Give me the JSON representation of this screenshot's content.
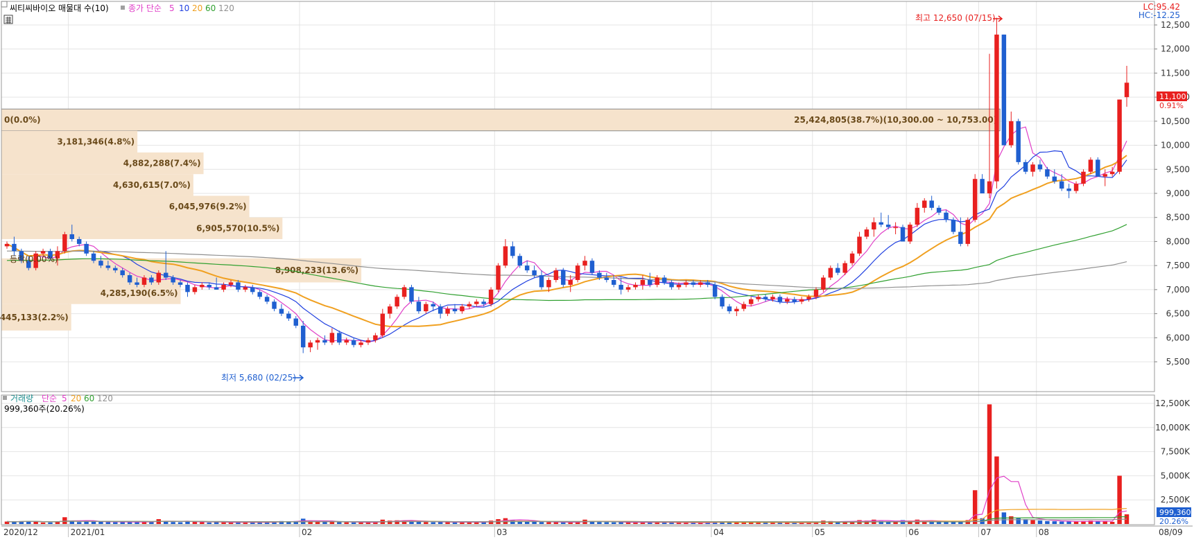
{
  "header": {
    "title": "씨티씨바이오 매물대 수(10)",
    "ma_prefix": "종가 단순",
    "ma_periods": [
      "5",
      "10",
      "20",
      "60",
      "120"
    ]
  },
  "volume_header": {
    "title": "거래량",
    "ma_prefix": "단순",
    "ma_periods": [
      "5",
      "20",
      "60",
      "120"
    ],
    "last_value": "999,360주(20.26%)"
  },
  "indicators": {
    "lc": "LC:95.42",
    "hc": "HC:-12.25"
  },
  "current": {
    "price": "11,100",
    "change": "0.91%",
    "volume": "999,360",
    "volume_pct": "20.26%"
  },
  "colors": {
    "up": "#e8201f",
    "down": "#1f5fd0",
    "ma5": "#e040c8",
    "ma10": "#2040e0",
    "ma20": "#f0a020",
    "ma60": "#30a030",
    "ma120": "#909090",
    "profile": "#f6e3cc",
    "grid": "#e4e4e4"
  },
  "annotations": {
    "high": "최고 12,650 (07/15)",
    "low": "최저 5,680 (02/25)",
    "ret": "등락(0.00%)"
  },
  "chart_data": {
    "type": "candlestick",
    "price_axis": {
      "ticks": [
        12500,
        12000,
        11500,
        11000,
        10500,
        10000,
        9500,
        9000,
        8500,
        8000,
        7500,
        7000,
        6500,
        6000,
        5500
      ],
      "tick_labels": [
        "12,500",
        "12,000",
        "11,500",
        "11,000",
        "10,500",
        "10,000",
        "9,500",
        "9,000",
        "8,500",
        "8,000",
        "7,500",
        "7,000",
        "6,500",
        "6,000",
        "5,500"
      ]
    },
    "volume_axis": {
      "ticks": [
        12500,
        10000,
        7500,
        5000,
        2500
      ],
      "tick_labels": [
        "12,500K",
        "10,000K",
        "7,500K",
        "5,000K",
        "2,500K"
      ]
    },
    "x_labels": [
      "2020/12",
      "2021/01",
      "02",
      "03",
      "04",
      "05",
      "06",
      "07",
      "08",
      "08/09"
    ],
    "candles": [
      [
        7900,
        8000,
        7850,
        7950,
        250
      ],
      [
        7950,
        8100,
        7700,
        7800,
        220
      ],
      [
        7800,
        7850,
        7550,
        7600,
        280
      ],
      [
        7600,
        7700,
        7400,
        7450,
        300
      ],
      [
        7450,
        7800,
        7400,
        7750,
        260
      ],
      [
        7750,
        7850,
        7700,
        7800,
        150
      ],
      [
        7800,
        7850,
        7600,
        7650,
        160
      ],
      [
        7650,
        7900,
        7500,
        7800,
        250
      ],
      [
        7800,
        8200,
        7750,
        8150,
        700
      ],
      [
        8150,
        8350,
        8000,
        8050,
        350
      ],
      [
        8050,
        8100,
        7900,
        7950,
        200
      ],
      [
        7950,
        8000,
        7700,
        7750,
        250
      ],
      [
        7750,
        7800,
        7550,
        7600,
        230
      ],
      [
        7600,
        7700,
        7450,
        7500,
        280
      ],
      [
        7500,
        7600,
        7400,
        7450,
        200
      ],
      [
        7450,
        7500,
        7350,
        7400,
        180
      ],
      [
        7400,
        7450,
        7250,
        7300,
        200
      ],
      [
        7300,
        7350,
        7100,
        7150,
        230
      ],
      [
        7150,
        7250,
        7050,
        7100,
        200
      ],
      [
        7100,
        7300,
        7050,
        7250,
        250
      ],
      [
        7250,
        7300,
        7100,
        7150,
        180
      ],
      [
        7150,
        7400,
        7100,
        7350,
        500
      ],
      [
        7350,
        7800,
        7200,
        7250,
        300
      ],
      [
        7250,
        7300,
        7100,
        7150,
        200
      ],
      [
        7150,
        7200,
        7050,
        7100,
        180
      ],
      [
        7100,
        7150,
        6850,
        6950,
        300
      ],
      [
        6950,
        7100,
        6900,
        7050,
        250
      ],
      [
        7050,
        7150,
        7000,
        7100,
        180
      ],
      [
        7100,
        7150,
        7000,
        7050,
        150
      ],
      [
        7050,
        7250,
        7000,
        7000,
        200
      ],
      [
        7000,
        7150,
        6950,
        7100,
        180
      ],
      [
        7100,
        7200,
        7050,
        7150,
        170
      ],
      [
        7150,
        7200,
        6950,
        7000,
        160
      ],
      [
        7000,
        7100,
        6950,
        7050,
        150
      ],
      [
        7050,
        7100,
        6900,
        6950,
        150
      ],
      [
        6950,
        7000,
        6800,
        6850,
        180
      ],
      [
        6850,
        6900,
        6700,
        6750,
        200
      ],
      [
        6750,
        6800,
        6550,
        6600,
        250
      ],
      [
        6600,
        6700,
        6450,
        6500,
        300
      ],
      [
        6500,
        6550,
        6350,
        6400,
        280
      ],
      [
        6400,
        6450,
        6200,
        6250,
        300
      ],
      [
        6250,
        6350,
        5680,
        5800,
        550
      ],
      [
        5800,
        5950,
        5700,
        5900,
        300
      ],
      [
        5900,
        6000,
        5750,
        5950,
        250
      ],
      [
        5950,
        6050,
        5850,
        5900,
        220
      ],
      [
        5900,
        6200,
        5850,
        6100,
        250
      ],
      [
        6100,
        6150,
        5850,
        5900,
        200
      ],
      [
        5900,
        6000,
        5850,
        5950,
        170
      ],
      [
        5950,
        6000,
        5800,
        5850,
        160
      ],
      [
        5850,
        5950,
        5800,
        5900,
        150
      ],
      [
        5900,
        6000,
        5850,
        5950,
        160
      ],
      [
        5950,
        6100,
        5900,
        6050,
        220
      ],
      [
        6050,
        6600,
        6000,
        6500,
        450
      ],
      [
        6500,
        6700,
        6400,
        6650,
        350
      ],
      [
        6650,
        6900,
        6600,
        6850,
        380
      ],
      [
        6850,
        7100,
        6800,
        7050,
        350
      ],
      [
        7050,
        7100,
        6700,
        6750,
        300
      ],
      [
        6750,
        6850,
        6500,
        6550,
        250
      ],
      [
        6550,
        6750,
        6500,
        6700,
        200
      ],
      [
        6700,
        6750,
        6550,
        6650,
        180
      ],
      [
        6650,
        6700,
        6400,
        6500,
        200
      ],
      [
        6500,
        6650,
        6450,
        6600,
        180
      ],
      [
        6600,
        6700,
        6500,
        6550,
        170
      ],
      [
        6550,
        6700,
        6500,
        6650,
        200
      ],
      [
        6650,
        6750,
        6600,
        6700,
        180
      ],
      [
        6700,
        6800,
        6650,
        6750,
        200
      ],
      [
        6750,
        6800,
        6650,
        6700,
        180
      ],
      [
        6700,
        7050,
        6650,
        7000,
        350
      ],
      [
        7000,
        7550,
        6950,
        7500,
        500
      ],
      [
        7500,
        8050,
        7450,
        7900,
        600
      ],
      [
        7900,
        8000,
        7650,
        7700,
        400
      ],
      [
        7700,
        7750,
        7450,
        7500,
        300
      ],
      [
        7500,
        7600,
        7350,
        7400,
        250
      ],
      [
        7400,
        7500,
        7250,
        7300,
        220
      ],
      [
        7300,
        7400,
        7000,
        7050,
        200
      ],
      [
        7050,
        7250,
        6950,
        7200,
        180
      ],
      [
        7200,
        7450,
        7150,
        7400,
        200
      ],
      [
        7400,
        7450,
        7050,
        7100,
        170
      ],
      [
        7100,
        7300,
        6950,
        7200,
        160
      ],
      [
        7200,
        7550,
        7150,
        7500,
        220
      ],
      [
        7500,
        7700,
        7400,
        7600,
        450
      ],
      [
        7600,
        7650,
        7300,
        7350,
        300
      ],
      [
        7350,
        7400,
        7200,
        7250,
        200
      ],
      [
        7250,
        7350,
        7150,
        7200,
        180
      ],
      [
        7200,
        7300,
        7050,
        7100,
        170
      ],
      [
        7100,
        7250,
        6900,
        7000,
        180
      ],
      [
        7000,
        7100,
        6950,
        7050,
        160
      ],
      [
        7050,
        7150,
        7000,
        7100,
        150
      ],
      [
        7100,
        7300,
        7000,
        7200,
        200
      ],
      [
        7200,
        7350,
        7050,
        7100,
        170
      ],
      [
        7100,
        7300,
        7050,
        7250,
        160
      ],
      [
        7250,
        7300,
        7100,
        7150,
        150
      ],
      [
        7150,
        7200,
        7000,
        7050,
        150
      ],
      [
        7050,
        7150,
        7000,
        7100,
        140
      ],
      [
        7100,
        7200,
        7050,
        7150,
        140
      ],
      [
        7150,
        7200,
        7050,
        7100,
        130
      ],
      [
        7100,
        7200,
        7050,
        7150,
        130
      ],
      [
        7150,
        7200,
        7050,
        7100,
        130
      ],
      [
        7100,
        7150,
        6800,
        6850,
        250
      ],
      [
        6850,
        6900,
        6600,
        6650,
        250
      ],
      [
        6650,
        6700,
        6500,
        6550,
        200
      ],
      [
        6550,
        6650,
        6450,
        6600,
        180
      ],
      [
        6600,
        6750,
        6550,
        6700,
        170
      ],
      [
        6700,
        6850,
        6650,
        6800,
        170
      ],
      [
        6800,
        6900,
        6750,
        6850,
        160
      ],
      [
        6850,
        6900,
        6750,
        6800,
        150
      ],
      [
        6800,
        6900,
        6750,
        6850,
        150
      ],
      [
        6850,
        6900,
        6700,
        6750,
        140
      ],
      [
        6750,
        6850,
        6700,
        6800,
        140
      ],
      [
        6800,
        6850,
        6700,
        6750,
        130
      ],
      [
        6750,
        6850,
        6700,
        6800,
        140
      ],
      [
        6800,
        6900,
        6750,
        6850,
        150
      ],
      [
        6850,
        7050,
        6800,
        7000,
        200
      ],
      [
        7000,
        7300,
        6950,
        7250,
        350
      ],
      [
        7250,
        7500,
        7200,
        7450,
        300
      ],
      [
        7450,
        7550,
        7300,
        7350,
        200
      ],
      [
        7350,
        7600,
        7300,
        7550,
        250
      ],
      [
        7550,
        7800,
        7500,
        7750,
        280
      ],
      [
        7750,
        8200,
        7700,
        8100,
        400
      ],
      [
        8100,
        8300,
        8050,
        8250,
        350
      ],
      [
        8250,
        8500,
        8100,
        8400,
        450
      ],
      [
        8400,
        8600,
        8300,
        8350,
        300
      ],
      [
        8350,
        8550,
        8250,
        8300,
        250
      ],
      [
        8300,
        8400,
        8150,
        8300,
        200
      ],
      [
        8300,
        8350,
        8000,
        8000,
        400
      ],
      [
        8000,
        8400,
        7950,
        8350,
        350
      ],
      [
        8350,
        8800,
        8300,
        8700,
        450
      ],
      [
        8700,
        8900,
        8600,
        8850,
        300
      ],
      [
        8850,
        8950,
        8650,
        8700,
        250
      ],
      [
        8700,
        8750,
        8550,
        8600,
        220
      ],
      [
        8600,
        8650,
        8400,
        8450,
        200
      ],
      [
        8450,
        8500,
        8150,
        8200,
        250
      ],
      [
        8200,
        8500,
        7900,
        7950,
        300
      ],
      [
        7950,
        8500,
        7900,
        8450,
        400
      ],
      [
        8450,
        9400,
        8400,
        9300,
        3500
      ],
      [
        9300,
        9400,
        9050,
        9000,
        600
      ],
      [
        9000,
        11900,
        8900,
        9250,
        12400
      ],
      [
        9250,
        12650,
        9100,
        12300,
        7000
      ],
      [
        12300,
        11000,
        10800,
        10000,
        1200
      ],
      [
        10000,
        10700,
        9950,
        10500,
        800
      ],
      [
        10500,
        10550,
        9600,
        9650,
        600
      ],
      [
        9650,
        9700,
        9400,
        9450,
        500
      ],
      [
        9450,
        9650,
        9350,
        9600,
        400
      ],
      [
        9600,
        9700,
        9450,
        9500,
        350
      ],
      [
        9500,
        9550,
        9300,
        9350,
        300
      ],
      [
        9350,
        9500,
        9200,
        9250,
        280
      ],
      [
        9250,
        9400,
        9050,
        9100,
        250
      ],
      [
        9100,
        9200,
        8900,
        9050,
        250
      ],
      [
        9050,
        9250,
        9000,
        9200,
        250
      ],
      [
        9200,
        9500,
        9150,
        9450,
        300
      ],
      [
        9450,
        9750,
        9400,
        9700,
        350
      ],
      [
        9700,
        9750,
        9350,
        9350,
        300
      ],
      [
        9350,
        9500,
        9150,
        9400,
        250
      ],
      [
        9400,
        9550,
        9350,
        9450,
        220
      ],
      [
        9450,
        10950,
        9400,
        10950,
        5000
      ],
      [
        11000,
        11650,
        10800,
        11300,
        999
      ]
    ],
    "ma_series": [
      {
        "name": "5",
        "period": 5
      },
      {
        "name": "10",
        "period": 10
      },
      {
        "name": "20",
        "period": 20
      },
      {
        "name": "60",
        "period": 60
      },
      {
        "name": "120",
        "period": 120
      }
    ],
    "volume_profile": [
      {
        "label": "25,424,805(38.7%)(10,300.00 ~ 10,753.00)",
        "low": 10300,
        "high": 10753,
        "pct": 38.7
      },
      {
        "label": "0(0.0%)",
        "low": 10753,
        "high": 10300,
        "pct": 0
      },
      {
        "label": "3,181,346(4.8%)",
        "low": 9850,
        "high": 10300,
        "pct": 4.8
      },
      {
        "label": "4,882,288(7.4%)",
        "low": 9400,
        "high": 9850,
        "pct": 7.4
      },
      {
        "label": "4,630,615(7.0%)",
        "low": 8950,
        "high": 9400,
        "pct": 7.0
      },
      {
        "label": "6,045,976(9.2%)",
        "low": 8500,
        "high": 8950,
        "pct": 9.2
      },
      {
        "label": "6,905,570(10.5%)",
        "low": 8050,
        "high": 8500,
        "pct": 10.5
      },
      {
        "label": "8,908,233(13.6%)",
        "low": 7150,
        "high": 7650,
        "pct": 13.6
      },
      {
        "label": "4,285,190(6.5%)",
        "low": 6700,
        "high": 7150,
        "pct": 6.5
      },
      {
        "label": "1,445,133(2.2%)",
        "low": 6150,
        "high": 6700,
        "pct": 2.2
      }
    ]
  }
}
